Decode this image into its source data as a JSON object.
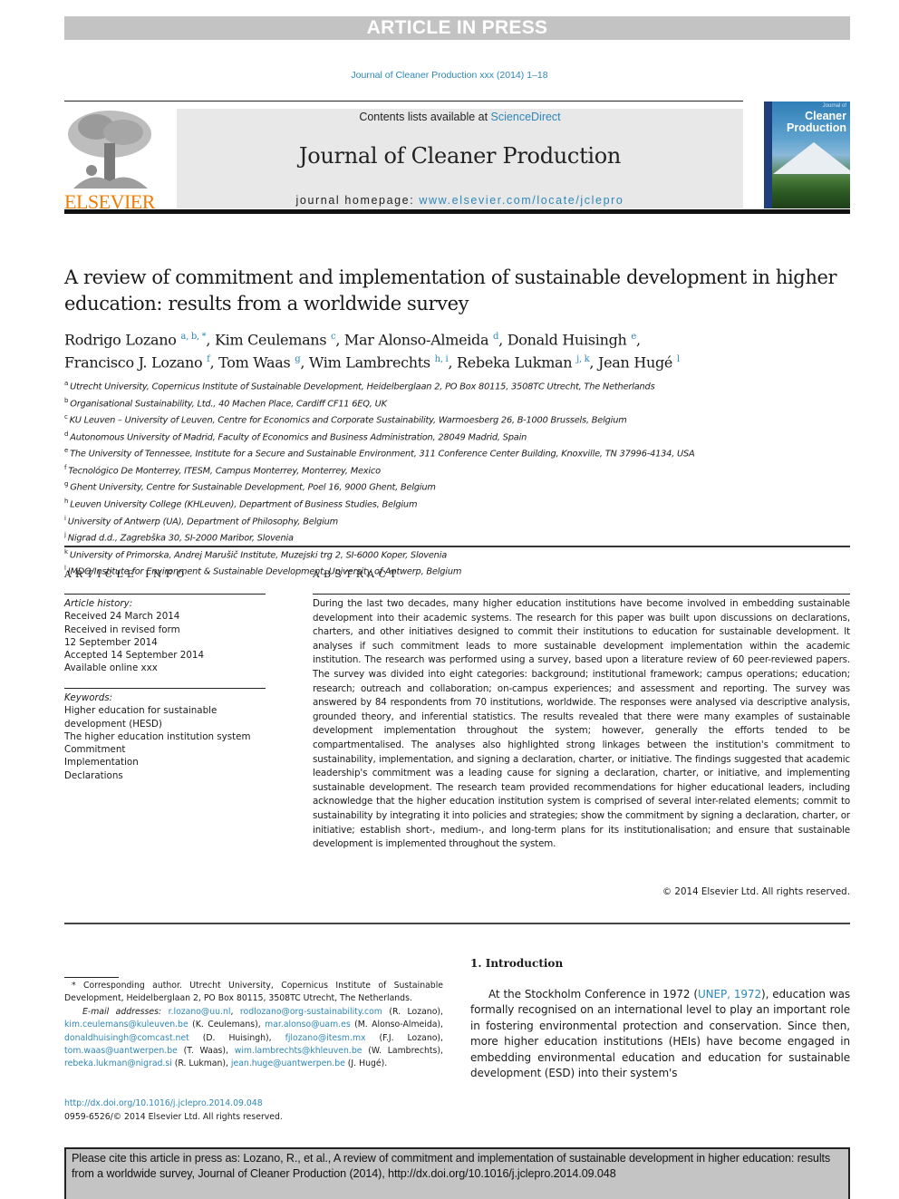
{
  "banner": {
    "text": "ARTICLE IN PRESS"
  },
  "journal_ref": "Journal of Cleaner Production xxx (2014) 1–18",
  "header": {
    "publisher": "ELSEVIER",
    "contents_prefix": "Contents lists available at ",
    "contents_link": "ScienceDirect",
    "journal_title": "Journal of Cleaner Production",
    "homepage_prefix": "journal homepage: ",
    "homepage_link": "www.elsevier.com/locate/jclepro",
    "cover_small": "Journal of",
    "cover_title_1": "Cleaner",
    "cover_title_2": "Production"
  },
  "article": {
    "title": "A review of commitment and implementation of sustainable development in higher education: results from a worldwide survey",
    "authors": [
      {
        "name": "Rodrigo Lozano",
        "sup": "a, b, *",
        "sep": ", "
      },
      {
        "name": "Kim Ceulemans",
        "sup": "c",
        "sep": ", "
      },
      {
        "name": "Mar Alonso-Almeida",
        "sup": "d",
        "sep": ", "
      },
      {
        "name": "Donald Huisingh",
        "sup": "e",
        "sep": ","
      },
      {
        "name": "Francisco J. Lozano",
        "sup": "f",
        "sep": ", "
      },
      {
        "name": "Tom Waas",
        "sup": "g",
        "sep": ", "
      },
      {
        "name": "Wim Lambrechts",
        "sup": "h, i",
        "sep": ", "
      },
      {
        "name": "Rebeka Lukman",
        "sup": "j, k",
        "sep": ", "
      },
      {
        "name": "Jean Hugé",
        "sup": "l",
        "sep": ""
      }
    ],
    "affiliations": [
      {
        "key": "a",
        "text": "Utrecht University, Copernicus Institute of Sustainable Development, Heidelberglaan 2, PO Box 80115, 3508TC Utrecht, The Netherlands"
      },
      {
        "key": "b",
        "text": "Organisational Sustainability, Ltd., 40 Machen Place, Cardiff CF11 6EQ, UK"
      },
      {
        "key": "c",
        "text": "KU Leuven – University of Leuven, Centre for Economics and Corporate Sustainability, Warmoesberg 26, B-1000 Brussels, Belgium"
      },
      {
        "key": "d",
        "text": "Autonomous University of Madrid, Faculty of Economics and Business Administration, 28049 Madrid, Spain"
      },
      {
        "key": "e",
        "text": "The University of Tennessee, Institute for a Secure and Sustainable Environment, 311 Conference Center Building, Knoxville, TN 37996-4134, USA"
      },
      {
        "key": "f",
        "text": "Tecnológico De Monterrey, ITESM, Campus Monterrey, Monterrey, Mexico"
      },
      {
        "key": "g",
        "text": "Ghent University, Centre for Sustainable Development, Poel 16, 9000 Ghent, Belgium"
      },
      {
        "key": "h",
        "text": "Leuven University College (KHLeuven), Department of Business Studies, Belgium"
      },
      {
        "key": "i",
        "text": "University of Antwerp (UA), Department of Philosophy, Belgium"
      },
      {
        "key": "j",
        "text": "Nigrad d.d., Zagrebška 30, SI-2000 Maribor, Slovenia"
      },
      {
        "key": "k",
        "text": "University of Primorska, Andrej Marušič Institute, Muzejski trg 2, SI-6000 Koper, Slovenia"
      },
      {
        "key": "l",
        "text": "IMDO/Institute for Environment & Sustainable Development, University of Antwerp, Belgium"
      }
    ]
  },
  "article_info": {
    "heading": "ARTICLE INFO",
    "history_label": "Article history:",
    "history": [
      "Received 24 March 2014",
      "Received in revised form",
      "12 September 2014",
      "Accepted 14 September 2014",
      "Available online xxx"
    ],
    "keywords_label": "Keywords:",
    "keywords": [
      "Higher education for sustainable",
      "development (HESD)",
      "The higher education institution system",
      "Commitment",
      "Implementation",
      "Declarations"
    ]
  },
  "abstract": {
    "heading": "ABSTRACT",
    "text": "During the last two decades, many higher education institutions have become involved in embedding sustainable development into their academic systems. The research for this paper was built upon discussions on declarations, charters, and other initiatives designed to commit their institutions to education for sustainable development. It analyses if such commitment leads to more sustainable development implementation within the academic institution. The research was performed using a survey, based upon a literature review of 60 peer-reviewed papers. The survey was divided into eight categories: background; institutional framework; campus operations; education; research; outreach and collaboration; on-campus experiences; and assessment and reporting. The survey was answered by 84 respondents from 70 institutions, worldwide. The responses were analysed via descriptive analysis, grounded theory, and inferential statistics. The results revealed that there were many examples of sustainable development implementation throughout the system; however, generally the efforts tended to be compartmentalised. The analyses also highlighted strong linkages between the institution's commitment to sustainability, implementation, and signing a declaration, charter, or initiative. The findings suggested that academic leadership's commitment was a leading cause for signing a declaration, charter, or initiative, and implementing sustainable development. The research team provided recommendations for higher educational leaders, including acknowledge that the higher education institution system is comprised of several inter-related elements; commit to sustainability by integrating it into policies and strategies; show the commitment by signing a declaration, charter, or initiative; establish short-, medium-, and long-term plans for its institutionalisation; and ensure that sustainable development is implemented throughout the system.",
    "copyright": "© 2014 Elsevier Ltd. All rights reserved."
  },
  "footnotes": {
    "corresponding": "* Corresponding author. Utrecht University, Copernicus Institute of Sustainable Development, Heidelberglaan 2, PO Box 80115, 3508TC Utrecht, The Netherlands.",
    "email_label": "E-mail addresses:",
    "emails": [
      {
        "email": "r.lozano@uu.nl",
        "who": ""
      },
      {
        "email": "rodlozano@org-sustainability.com",
        "who": "(R. Lozano)"
      },
      {
        "email": "kim.ceulemans@kuleuven.be",
        "who": "(K. Ceulemans)"
      },
      {
        "email": "mar.alonso@uam.es",
        "who": "(M. Alonso-Almeida)"
      },
      {
        "email": "donaldhuisingh@comcast.net",
        "who": "(D. Huisingh)"
      },
      {
        "email": "fjlozano@itesm.mx",
        "who": "(F.J. Lozano)"
      },
      {
        "email": "tom.waas@uantwerpen.be",
        "who": "(T. Waas)"
      },
      {
        "email": "wim.lambrechts@khleuven.be",
        "who": "(W. Lambrechts)"
      },
      {
        "email": "rebeka.lukman@nigrad.si",
        "who": "(R. Lukman)"
      },
      {
        "email": "jean.huge@uantwerpen.be",
        "who": "(J. Hugé)."
      }
    ],
    "doi": "http://dx.doi.org/10.1016/j.jclepro.2014.09.048",
    "issn": "0959-6526/© 2014 Elsevier Ltd. All rights reserved."
  },
  "introduction": {
    "heading": "1.  Introduction",
    "text_before": "At the Stockholm Conference in 1972 (",
    "citation": "UNEP, 1972",
    "text_after": "), education was formally recognised on an international level to play an important role in fostering environmental protection and conservation. Since then, more higher education institutions (HEIs) have become engaged in embedding environmental education and education for sustainable development (ESD) into their system's"
  },
  "cite_box": "Please cite this article in press as: Lozano, R., et al., A review of commitment and implementation of sustainable development in higher education: results from a worldwide survey, Journal of Cleaner Production (2014), http://dx.doi.org/10.1016/j.jclepro.2014.09.048"
}
